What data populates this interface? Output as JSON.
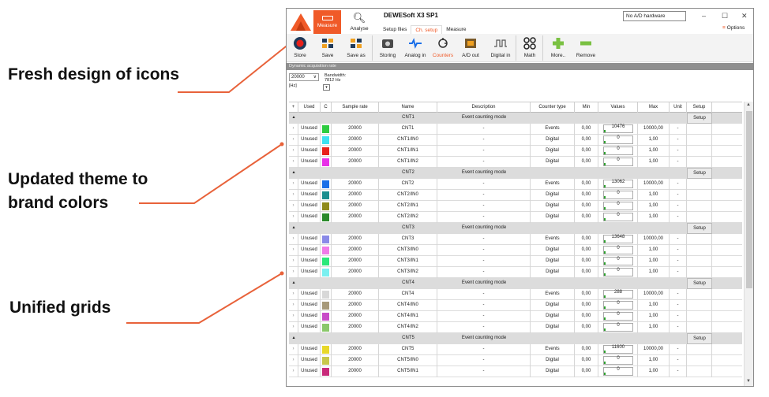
{
  "callouts": {
    "icons": "Fresh design of icons",
    "theme": "Updated theme to\nbrand colors",
    "grids": "Unified grids"
  },
  "colors": {
    "accent": "#f05a28",
    "callout_line": "#e8623a"
  },
  "window": {
    "title": "DEWESoft X3 SP1",
    "main_tabs": [
      {
        "label": "Measure",
        "icon": "monitor-icon"
      },
      {
        "label": "Analyse",
        "icon": "magnifier-icon"
      }
    ],
    "sub_tabs": [
      "Setup files",
      "Ch. setup",
      "Measure"
    ],
    "active_sub_tab": "Ch. setup",
    "hardware_status": "No A/D hardware",
    "options_label": "Options",
    "window_controls": [
      "–",
      "☐",
      "✕"
    ],
    "options_glyph": "≡"
  },
  "ribbon": [
    {
      "label": "Store",
      "icon": "record-icon"
    },
    {
      "label": "Save",
      "icon": "save-icon"
    },
    {
      "label": "Save as",
      "icon": "save-as-icon"
    },
    {
      "label": "Storing",
      "icon": "storing-icon"
    },
    {
      "label": "Analog in",
      "icon": "analog-in-icon"
    },
    {
      "label": "Counters",
      "icon": "counters-icon"
    },
    {
      "label": "A/D out",
      "icon": "ad-out-icon"
    },
    {
      "label": "Digital in",
      "icon": "digital-in-icon"
    },
    {
      "label": "Math",
      "icon": "math-icon"
    },
    {
      "label": "More..",
      "icon": "plus-icon"
    },
    {
      "label": "Remove",
      "icon": "minus-icon"
    }
  ],
  "acquisition": {
    "bar_label": "Dynamic acquisition rate",
    "rate": "20000",
    "unit": "[Hz]",
    "bandwidth_label": "Bandwidth:",
    "bandwidth_value": "7812 Hz"
  },
  "grid": {
    "columns": [
      "+",
      "Used",
      "C",
      "Sample rate",
      "Name",
      "Description",
      "Counter type",
      "Min",
      "Values",
      "Max",
      "Unit",
      "Setup"
    ],
    "group_description": "Event counting mode",
    "setup_label": "Setup",
    "groups": [
      {
        "name": "CNT1",
        "channels": [
          {
            "used": "Unused",
            "color": "#2ecc40",
            "rate": "20000",
            "name": "CNT1",
            "desc": "-",
            "type": "Events",
            "min": "0,00",
            "value": "10476",
            "max": "10000,00",
            "unit": "-"
          },
          {
            "used": "Unused",
            "color": "#3de0f0",
            "rate": "20000",
            "name": "CNT1/IN0",
            "desc": "-",
            "type": "Digital",
            "min": "0,00",
            "value": "0",
            "max": "1,00",
            "unit": "-"
          },
          {
            "used": "Unused",
            "color": "#e8201a",
            "rate": "20000",
            "name": "CNT1/IN1",
            "desc": "-",
            "type": "Digital",
            "min": "0,00",
            "value": "0",
            "max": "1,00",
            "unit": "-"
          },
          {
            "used": "Unused",
            "color": "#e830e8",
            "rate": "20000",
            "name": "CNT1/IN2",
            "desc": "-",
            "type": "Digital",
            "min": "0,00",
            "value": "0",
            "max": "1,00",
            "unit": "-"
          }
        ]
      },
      {
        "name": "CNT2",
        "channels": [
          {
            "used": "Unused",
            "color": "#1a6fe8",
            "rate": "20000",
            "name": "CNT2",
            "desc": "-",
            "type": "Events",
            "min": "0,00",
            "value": "13062",
            "max": "10000,00",
            "unit": "-"
          },
          {
            "used": "Unused",
            "color": "#1a8f8f",
            "rate": "20000",
            "name": "CNT2/IN0",
            "desc": "-",
            "type": "Digital",
            "min": "0,00",
            "value": "0",
            "max": "1,00",
            "unit": "-"
          },
          {
            "used": "Unused",
            "color": "#8f8a1a",
            "rate": "20000",
            "name": "CNT2/IN1",
            "desc": "-",
            "type": "Digital",
            "min": "0,00",
            "value": "0",
            "max": "1,00",
            "unit": "-"
          },
          {
            "used": "Unused",
            "color": "#2a8a2a",
            "rate": "20000",
            "name": "CNT2/IN2",
            "desc": "-",
            "type": "Digital",
            "min": "0,00",
            "value": "0",
            "max": "1,00",
            "unit": "-"
          }
        ]
      },
      {
        "name": "CNT3",
        "channels": [
          {
            "used": "Unused",
            "color": "#8a8ae8",
            "rate": "20000",
            "name": "CNT3",
            "desc": "-",
            "type": "Events",
            "min": "0,00",
            "value": "13648",
            "max": "10000,00",
            "unit": "-"
          },
          {
            "used": "Unused",
            "color": "#f07ae8",
            "rate": "20000",
            "name": "CNT3/IN0",
            "desc": "-",
            "type": "Digital",
            "min": "0,00",
            "value": "0",
            "max": "1,00",
            "unit": "-"
          },
          {
            "used": "Unused",
            "color": "#2ae87a",
            "rate": "20000",
            "name": "CNT3/IN1",
            "desc": "-",
            "type": "Digital",
            "min": "0,00",
            "value": "0",
            "max": "1,00",
            "unit": "-"
          },
          {
            "used": "Unused",
            "color": "#7af0f0",
            "rate": "20000",
            "name": "CNT3/IN2",
            "desc": "-",
            "type": "Digital",
            "min": "0,00",
            "value": "0",
            "max": "1,00",
            "unit": "-"
          }
        ]
      },
      {
        "name": "CNT4",
        "channels": [
          {
            "used": "Unused",
            "color": "#d8d8d8",
            "rate": "20000",
            "name": "CNT4",
            "desc": "-",
            "type": "Events",
            "min": "0,00",
            "value": "288",
            "max": "10000,00",
            "unit": "-"
          },
          {
            "used": "Unused",
            "color": "#a89a7a",
            "rate": "20000",
            "name": "CNT4/IN0",
            "desc": "-",
            "type": "Digital",
            "min": "0,00",
            "value": "0",
            "max": "1,00",
            "unit": "-"
          },
          {
            "used": "Unused",
            "color": "#c84ac8",
            "rate": "20000",
            "name": "CNT4/IN1",
            "desc": "-",
            "type": "Digital",
            "min": "0,00",
            "value": "0",
            "max": "1,00",
            "unit": "-"
          },
          {
            "used": "Unused",
            "color": "#8ac86a",
            "rate": "20000",
            "name": "CNT4/IN2",
            "desc": "-",
            "type": "Digital",
            "min": "0,00",
            "value": "0",
            "max": "1,00",
            "unit": "-"
          }
        ]
      },
      {
        "name": "CNT5",
        "channels": [
          {
            "used": "Unused",
            "color": "#e8d82a",
            "rate": "20000",
            "name": "CNT5",
            "desc": "-",
            "type": "Events",
            "min": "0,00",
            "value": "11600",
            "max": "10000,00",
            "unit": "-"
          },
          {
            "used": "Unused",
            "color": "#c8c84a",
            "rate": "20000",
            "name": "CNT5/IN0",
            "desc": "-",
            "type": "Digital",
            "min": "0,00",
            "value": "0",
            "max": "1,00",
            "unit": "-"
          },
          {
            "used": "Unused",
            "color": "#c82a7a",
            "rate": "20000",
            "name": "CNT5/IN1",
            "desc": "-",
            "type": "Digital",
            "min": "0,00",
            "value": "0",
            "max": "1,00",
            "unit": "-"
          }
        ]
      }
    ]
  }
}
